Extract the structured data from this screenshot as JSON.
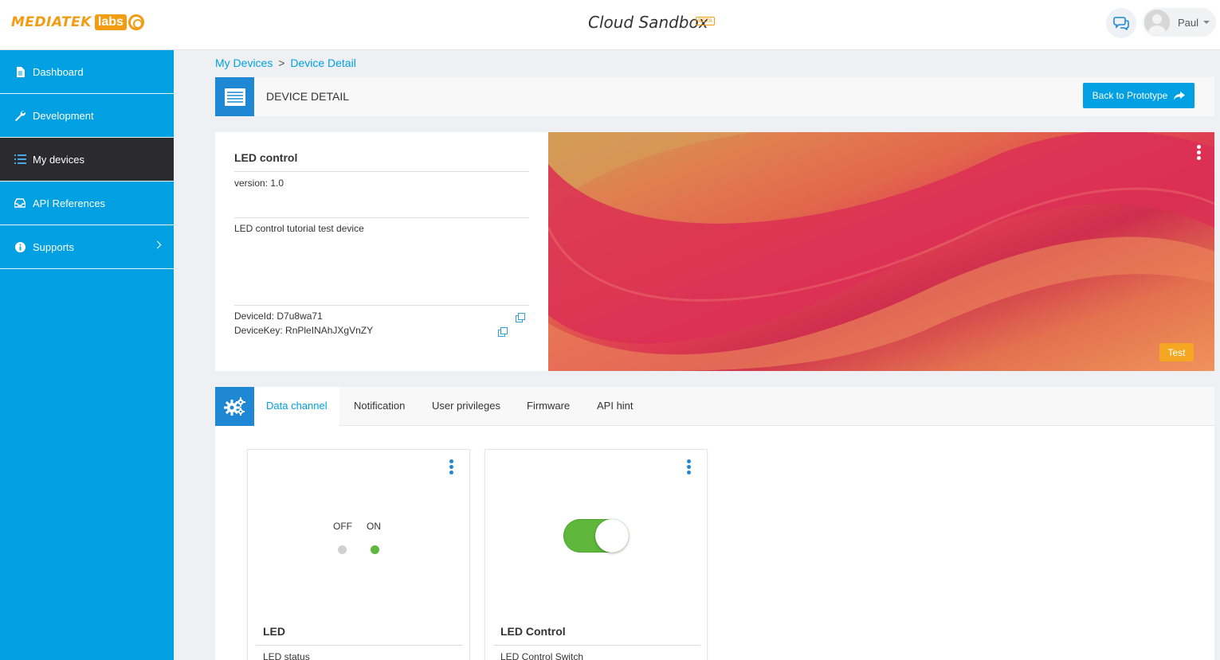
{
  "header": {
    "logo_brand": "MEDIATEK",
    "logo_labs": "labs",
    "app_title": "Cloud Sandbox",
    "beta_label": "BETA",
    "user_name": "Paul"
  },
  "sidebar": {
    "items": [
      {
        "label": "Dashboard",
        "icon": "document-icon"
      },
      {
        "label": "Development",
        "icon": "wrench-icon"
      },
      {
        "label": "My devices",
        "icon": "list-icon",
        "active": true
      },
      {
        "label": "API References",
        "icon": "inbox-icon"
      },
      {
        "label": "Supports",
        "icon": "info-icon"
      }
    ]
  },
  "breadcrumb": {
    "root": "My Devices",
    "separator": ">",
    "current": "Device Detail"
  },
  "detail_header": {
    "title": "DEVICE DETAIL",
    "back_button": "Back to Prototype"
  },
  "device": {
    "name": "LED control",
    "version_label": "version:",
    "version": "1.0",
    "description": "LED control tutorial test device",
    "device_id_label": "DeviceId:",
    "device_id": "D7u8wa71",
    "device_key_label": "DeviceKey:",
    "device_key": "RnPleINAhJXgVnZY",
    "badge": "Test"
  },
  "tabs": [
    {
      "label": "Data channel",
      "active": true
    },
    {
      "label": "Notification"
    },
    {
      "label": "User privileges"
    },
    {
      "label": "Firmware"
    },
    {
      "label": "API hint"
    }
  ],
  "channels": [
    {
      "title": "LED",
      "subtitle": "LED status",
      "off_label": "OFF",
      "on_label": "ON",
      "state": "ON"
    },
    {
      "title": "LED Control",
      "subtitle": "LED Control Switch",
      "switch_on": true
    }
  ],
  "colors": {
    "sidebar": "#00a0e3",
    "sidebar_active": "#2a2a2f",
    "accent": "#1e88d4",
    "logo": "#f39c12",
    "on_green": "#5fb83c",
    "badge_orange": "#f5a623"
  }
}
